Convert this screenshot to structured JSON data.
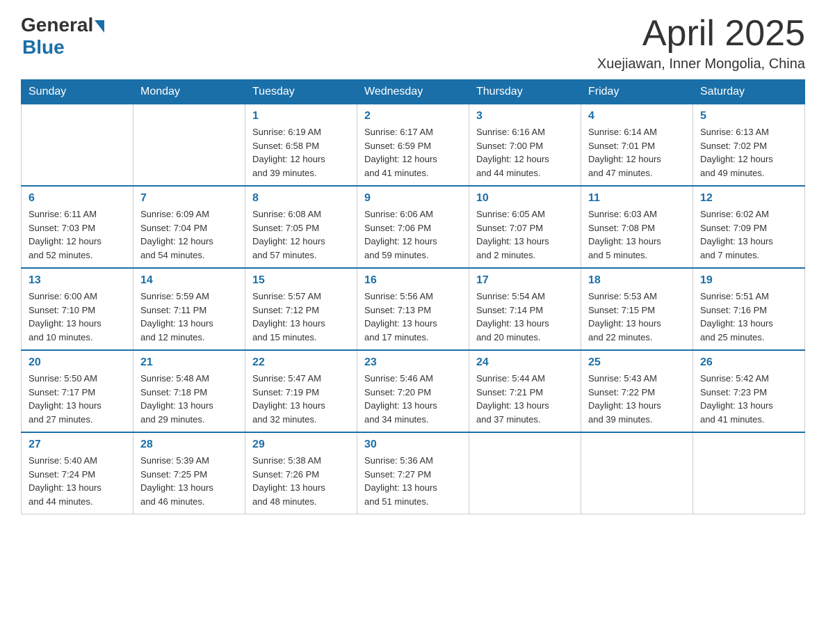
{
  "header": {
    "logo": {
      "text_general": "General",
      "text_blue": "Blue"
    },
    "title": "April 2025",
    "location": "Xuejiawan, Inner Mongolia, China"
  },
  "calendar": {
    "days_of_week": [
      "Sunday",
      "Monday",
      "Tuesday",
      "Wednesday",
      "Thursday",
      "Friday",
      "Saturday"
    ],
    "weeks": [
      [
        {
          "day": "",
          "info": ""
        },
        {
          "day": "",
          "info": ""
        },
        {
          "day": "1",
          "info": "Sunrise: 6:19 AM\nSunset: 6:58 PM\nDaylight: 12 hours\nand 39 minutes."
        },
        {
          "day": "2",
          "info": "Sunrise: 6:17 AM\nSunset: 6:59 PM\nDaylight: 12 hours\nand 41 minutes."
        },
        {
          "day": "3",
          "info": "Sunrise: 6:16 AM\nSunset: 7:00 PM\nDaylight: 12 hours\nand 44 minutes."
        },
        {
          "day": "4",
          "info": "Sunrise: 6:14 AM\nSunset: 7:01 PM\nDaylight: 12 hours\nand 47 minutes."
        },
        {
          "day": "5",
          "info": "Sunrise: 6:13 AM\nSunset: 7:02 PM\nDaylight: 12 hours\nand 49 minutes."
        }
      ],
      [
        {
          "day": "6",
          "info": "Sunrise: 6:11 AM\nSunset: 7:03 PM\nDaylight: 12 hours\nand 52 minutes."
        },
        {
          "day": "7",
          "info": "Sunrise: 6:09 AM\nSunset: 7:04 PM\nDaylight: 12 hours\nand 54 minutes."
        },
        {
          "day": "8",
          "info": "Sunrise: 6:08 AM\nSunset: 7:05 PM\nDaylight: 12 hours\nand 57 minutes."
        },
        {
          "day": "9",
          "info": "Sunrise: 6:06 AM\nSunset: 7:06 PM\nDaylight: 12 hours\nand 59 minutes."
        },
        {
          "day": "10",
          "info": "Sunrise: 6:05 AM\nSunset: 7:07 PM\nDaylight: 13 hours\nand 2 minutes."
        },
        {
          "day": "11",
          "info": "Sunrise: 6:03 AM\nSunset: 7:08 PM\nDaylight: 13 hours\nand 5 minutes."
        },
        {
          "day": "12",
          "info": "Sunrise: 6:02 AM\nSunset: 7:09 PM\nDaylight: 13 hours\nand 7 minutes."
        }
      ],
      [
        {
          "day": "13",
          "info": "Sunrise: 6:00 AM\nSunset: 7:10 PM\nDaylight: 13 hours\nand 10 minutes."
        },
        {
          "day": "14",
          "info": "Sunrise: 5:59 AM\nSunset: 7:11 PM\nDaylight: 13 hours\nand 12 minutes."
        },
        {
          "day": "15",
          "info": "Sunrise: 5:57 AM\nSunset: 7:12 PM\nDaylight: 13 hours\nand 15 minutes."
        },
        {
          "day": "16",
          "info": "Sunrise: 5:56 AM\nSunset: 7:13 PM\nDaylight: 13 hours\nand 17 minutes."
        },
        {
          "day": "17",
          "info": "Sunrise: 5:54 AM\nSunset: 7:14 PM\nDaylight: 13 hours\nand 20 minutes."
        },
        {
          "day": "18",
          "info": "Sunrise: 5:53 AM\nSunset: 7:15 PM\nDaylight: 13 hours\nand 22 minutes."
        },
        {
          "day": "19",
          "info": "Sunrise: 5:51 AM\nSunset: 7:16 PM\nDaylight: 13 hours\nand 25 minutes."
        }
      ],
      [
        {
          "day": "20",
          "info": "Sunrise: 5:50 AM\nSunset: 7:17 PM\nDaylight: 13 hours\nand 27 minutes."
        },
        {
          "day": "21",
          "info": "Sunrise: 5:48 AM\nSunset: 7:18 PM\nDaylight: 13 hours\nand 29 minutes."
        },
        {
          "day": "22",
          "info": "Sunrise: 5:47 AM\nSunset: 7:19 PM\nDaylight: 13 hours\nand 32 minutes."
        },
        {
          "day": "23",
          "info": "Sunrise: 5:46 AM\nSunset: 7:20 PM\nDaylight: 13 hours\nand 34 minutes."
        },
        {
          "day": "24",
          "info": "Sunrise: 5:44 AM\nSunset: 7:21 PM\nDaylight: 13 hours\nand 37 minutes."
        },
        {
          "day": "25",
          "info": "Sunrise: 5:43 AM\nSunset: 7:22 PM\nDaylight: 13 hours\nand 39 minutes."
        },
        {
          "day": "26",
          "info": "Sunrise: 5:42 AM\nSunset: 7:23 PM\nDaylight: 13 hours\nand 41 minutes."
        }
      ],
      [
        {
          "day": "27",
          "info": "Sunrise: 5:40 AM\nSunset: 7:24 PM\nDaylight: 13 hours\nand 44 minutes."
        },
        {
          "day": "28",
          "info": "Sunrise: 5:39 AM\nSunset: 7:25 PM\nDaylight: 13 hours\nand 46 minutes."
        },
        {
          "day": "29",
          "info": "Sunrise: 5:38 AM\nSunset: 7:26 PM\nDaylight: 13 hours\nand 48 minutes."
        },
        {
          "day": "30",
          "info": "Sunrise: 5:36 AM\nSunset: 7:27 PM\nDaylight: 13 hours\nand 51 minutes."
        },
        {
          "day": "",
          "info": ""
        },
        {
          "day": "",
          "info": ""
        },
        {
          "day": "",
          "info": ""
        }
      ]
    ]
  }
}
